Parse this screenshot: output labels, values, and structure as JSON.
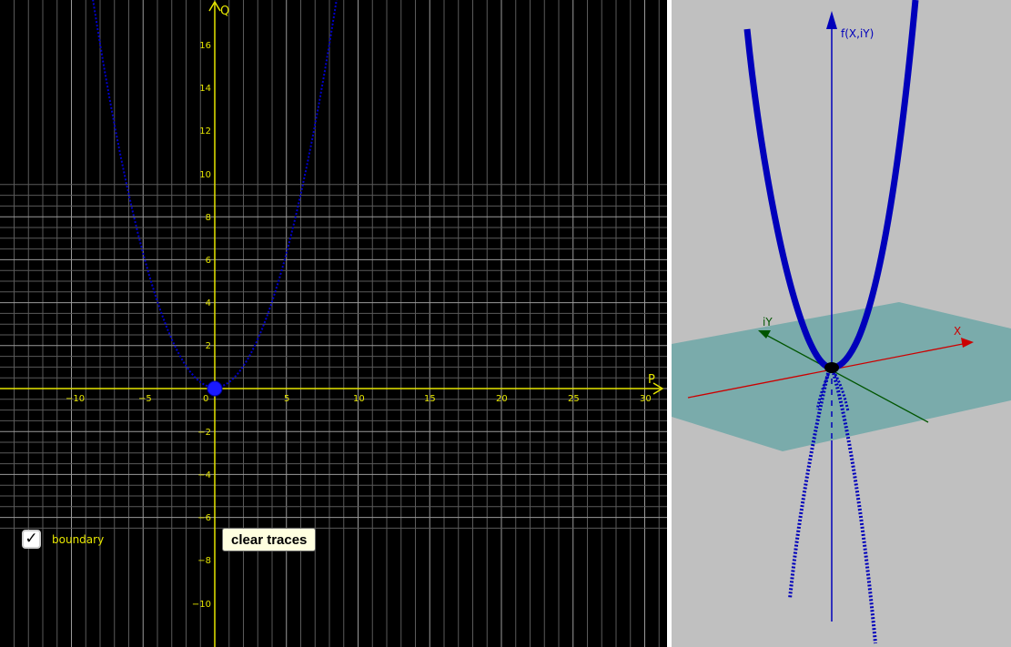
{
  "view2d": {
    "x_axis_label": "P",
    "y_axis_label": "Q",
    "x_ticks": [
      "−10",
      "−5",
      "0",
      "5",
      "10",
      "15",
      "20",
      "25",
      "30"
    ],
    "y_ticks_pos": [
      "2",
      "4",
      "6",
      "8",
      "10",
      "12",
      "14",
      "16"
    ],
    "y_ticks_neg": [
      "−2",
      "−4",
      "−6",
      "−8",
      "−10"
    ],
    "grid": true,
    "point_color": "#1a1aff",
    "curve_color": "#0000cc",
    "axis_color": "#e6e600"
  },
  "controls": {
    "boundary_checkbox": {
      "label": "boundary",
      "checked": true
    },
    "clear_traces_label": "clear traces"
  },
  "view3d": {
    "z_axis_label": "f(X,iY)",
    "x_axis_label": "X",
    "y_axis_label": "iY",
    "plane_color": "#7aabab",
    "curve_color": "#0000bb"
  }
}
